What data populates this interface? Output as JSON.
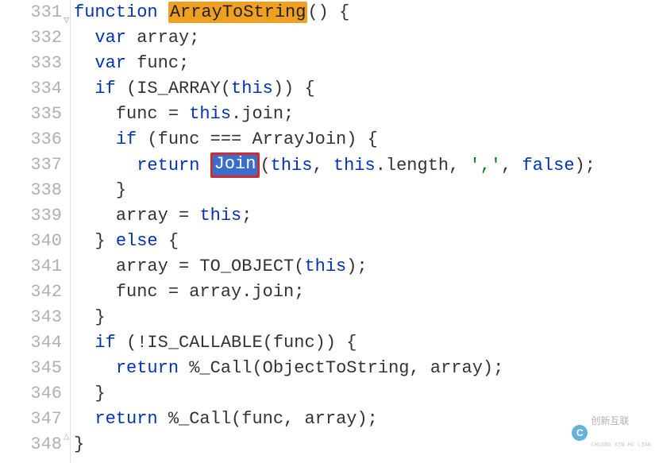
{
  "gutter": {
    "start": 331,
    "end": 348
  },
  "code": {
    "lines": [
      {
        "n": 331,
        "indent": "",
        "tokens": [
          {
            "t": "function ",
            "c": "kw"
          },
          {
            "t": "ArrayToString",
            "c": "fnname-hl"
          },
          {
            "t": "() {",
            "c": "punct"
          }
        ]
      },
      {
        "n": 332,
        "indent": "  ",
        "tokens": [
          {
            "t": "var ",
            "c": "kw"
          },
          {
            "t": "array;",
            "c": "ident"
          }
        ]
      },
      {
        "n": 333,
        "indent": "  ",
        "tokens": [
          {
            "t": "var ",
            "c": "kw"
          },
          {
            "t": "func;",
            "c": "ident"
          }
        ]
      },
      {
        "n": 334,
        "indent": "  ",
        "tokens": [
          {
            "t": "if ",
            "c": "kw"
          },
          {
            "t": "(IS_ARRAY(",
            "c": "ident"
          },
          {
            "t": "this",
            "c": "kw"
          },
          {
            "t": ")) {",
            "c": "punct"
          }
        ]
      },
      {
        "n": 335,
        "indent": "    ",
        "tokens": [
          {
            "t": "func = ",
            "c": "ident"
          },
          {
            "t": "this",
            "c": "kw"
          },
          {
            "t": ".join;",
            "c": "ident"
          }
        ]
      },
      {
        "n": 336,
        "indent": "    ",
        "tokens": [
          {
            "t": "if ",
            "c": "kw"
          },
          {
            "t": "(func === ArrayJoin) {",
            "c": "ident"
          }
        ]
      },
      {
        "n": 337,
        "indent": "      ",
        "tokens": [
          {
            "t": "return ",
            "c": "kw"
          },
          {
            "t": "Join",
            "c": "selbox"
          },
          {
            "t": "(",
            "c": "punct"
          },
          {
            "t": "this",
            "c": "kw"
          },
          {
            "t": ", ",
            "c": "punct"
          },
          {
            "t": "this",
            "c": "kw"
          },
          {
            "t": ".length, ",
            "c": "ident"
          },
          {
            "t": "','",
            "c": "str"
          },
          {
            "t": ", ",
            "c": "punct"
          },
          {
            "t": "false",
            "c": "kw"
          },
          {
            "t": ");",
            "c": "punct"
          }
        ]
      },
      {
        "n": 338,
        "indent": "    ",
        "tokens": [
          {
            "t": "}",
            "c": "punct"
          }
        ]
      },
      {
        "n": 339,
        "indent": "    ",
        "tokens": [
          {
            "t": "array = ",
            "c": "ident"
          },
          {
            "t": "this",
            "c": "kw"
          },
          {
            "t": ";",
            "c": "punct"
          }
        ]
      },
      {
        "n": 340,
        "indent": "  ",
        "tokens": [
          {
            "t": "} ",
            "c": "punct"
          },
          {
            "t": "else",
            "c": "kw"
          },
          {
            "t": " {",
            "c": "punct"
          }
        ]
      },
      {
        "n": 341,
        "indent": "    ",
        "tokens": [
          {
            "t": "array = TO_OBJECT(",
            "c": "ident"
          },
          {
            "t": "this",
            "c": "kw"
          },
          {
            "t": ");",
            "c": "punct"
          }
        ]
      },
      {
        "n": 342,
        "indent": "    ",
        "tokens": [
          {
            "t": "func = array.join;",
            "c": "ident"
          }
        ]
      },
      {
        "n": 343,
        "indent": "  ",
        "tokens": [
          {
            "t": "}",
            "c": "punct"
          }
        ]
      },
      {
        "n": 344,
        "indent": "  ",
        "tokens": [
          {
            "t": "if ",
            "c": "kw"
          },
          {
            "t": "(!IS_CALLABLE(func)) {",
            "c": "ident"
          }
        ]
      },
      {
        "n": 345,
        "indent": "    ",
        "tokens": [
          {
            "t": "return ",
            "c": "kw"
          },
          {
            "t": "%_Call(ObjectToString, array);",
            "c": "ident"
          }
        ]
      },
      {
        "n": 346,
        "indent": "  ",
        "tokens": [
          {
            "t": "}",
            "c": "punct"
          }
        ]
      },
      {
        "n": 347,
        "indent": "  ",
        "tokens": [
          {
            "t": "return ",
            "c": "kw"
          },
          {
            "t": "%_Call(func, array);",
            "c": "ident"
          }
        ]
      },
      {
        "n": 348,
        "indent": "",
        "tokens": [
          {
            "t": "}",
            "c": "punct"
          }
        ]
      }
    ]
  },
  "fold_marks": [
    {
      "line": 331,
      "type": "open"
    },
    {
      "line": 348,
      "type": "close"
    }
  ],
  "watermark": {
    "logo_letter": "C",
    "text_main": "创新互联",
    "text_sub": "CHUANG XIN HU LIAN"
  },
  "highlight": {
    "selected_word": "Join",
    "function_name_highlight": "ArrayToString"
  }
}
